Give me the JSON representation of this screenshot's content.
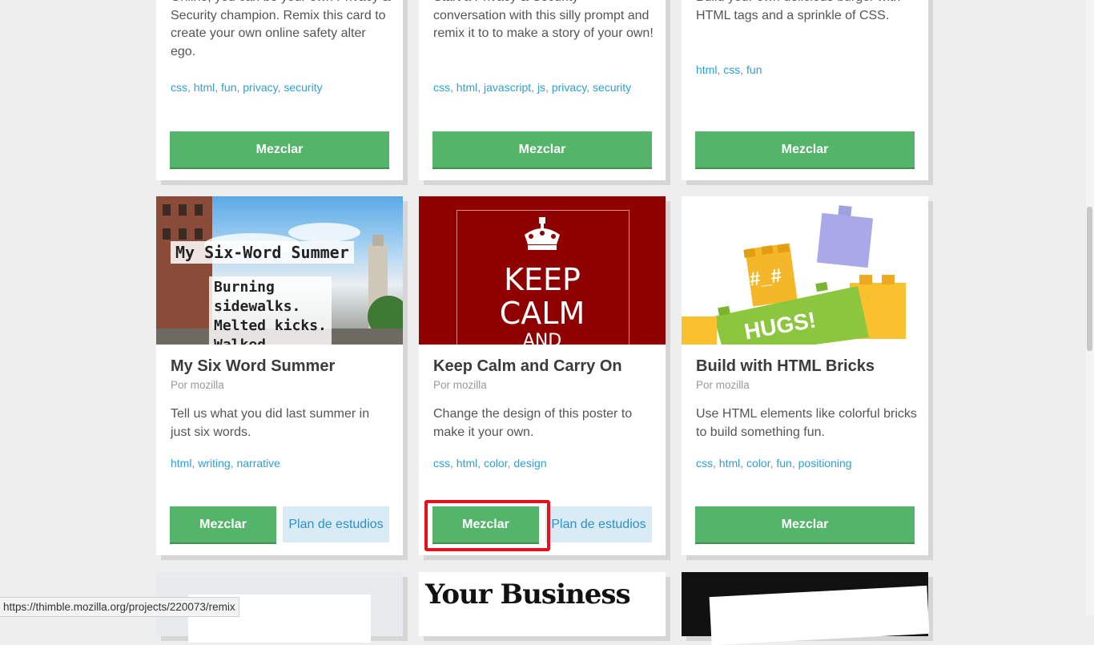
{
  "top_row": [
    {
      "desc": "Online, you can be your own Privacy & Security champion. Remix this card to create your own online safety alter ego.",
      "tags": [
        "css",
        "html",
        "fun",
        "privacy",
        "security"
      ],
      "remix_label": "Mezclar"
    },
    {
      "desc": "Start a Privacy & Security conversation with this silly prompt and remix it to to make a story of your own!",
      "tags": [
        "css",
        "html",
        "javascript",
        "js",
        "privacy",
        "security"
      ],
      "remix_label": "Mezclar"
    },
    {
      "desc": "Build your own delicious burger with HTML tags and a sprinkle of CSS.",
      "tags": [
        "html",
        "css",
        "fun"
      ],
      "remix_label": "Mezclar"
    }
  ],
  "middle_row": [
    {
      "title": "My Six Word Summer",
      "author": "Por mozilla",
      "desc": "Tell us what you did last summer in just six words.",
      "tags": [
        "html",
        "writing",
        "narrative"
      ],
      "remix_label": "Mezclar",
      "curriculum_label": "Plan de estudios",
      "thumb_text": {
        "heading": "My Six-Word Summer",
        "line1": "Burning",
        "line2": "sidewalks.",
        "line3": "Melted kicks.",
        "line4": "Walked"
      }
    },
    {
      "title": "Keep Calm and Carry On",
      "author": "Por mozilla",
      "desc": "Change the design of this poster to make it your own.",
      "tags": [
        "css",
        "html",
        "color",
        "design"
      ],
      "remix_label": "Mezclar",
      "curriculum_label": "Plan de estudios",
      "thumb_text": {
        "line1": "KEEP",
        "line2": "CALM",
        "line3": "AND"
      }
    },
    {
      "title": "Build with HTML Bricks",
      "author": "Por mozilla",
      "desc": "Use HTML elements like colorful bricks to build something fun.",
      "tags": [
        "css",
        "html",
        "color",
        "fun",
        "positioning"
      ],
      "remix_label": "Mezclar",
      "thumb_text": {
        "brick1": "#_#",
        "brick2": "HUGS!"
      }
    }
  ],
  "bottom_row": {
    "card2_thumb_text": "Your Business"
  },
  "status_url": "https://thimble.mozilla.org/projects/220073/remix",
  "colors": {
    "button_green": "#54b46a",
    "tag_blue": "#2d9fd9",
    "highlight_red": "#e8111b",
    "keep_calm_red": "#8f0000"
  }
}
